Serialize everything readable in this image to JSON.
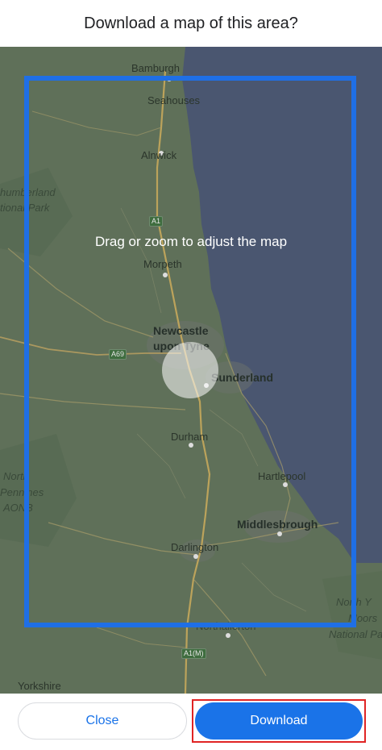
{
  "dialog": {
    "title": "Download a map of this area?",
    "hint": "Drag or zoom to adjust the map"
  },
  "map": {
    "places": {
      "bamburgh": "Bamburgh",
      "seahouses": "Seahouses",
      "alnwick": "Alnwick",
      "northumberland": "humberland",
      "national_park": "tional Park",
      "morpeth": "Morpeth",
      "newcastle_line1": "Newcastle",
      "newcastle_line2": "upon Tyne",
      "sunderland": "Sunderland",
      "durham": "Durham",
      "hartlepool": "Hartlepool",
      "north_pennines_1": "North",
      "north_pennines_2": "Pennines",
      "north_pennines_3": "AONB",
      "middlesbrough": "Middlesbrough",
      "darlington": "Darlington",
      "north_york_1": "North Y",
      "north_york_2": "Moors",
      "north_york_3": "National Pa",
      "northallerton": "Northallerton",
      "yorkshire": "Yorkshire"
    },
    "roads": {
      "a1": "A1",
      "a69": "A69",
      "a1m": "A1(M)"
    }
  },
  "footer": {
    "close_label": "Close",
    "download_label": "Download"
  },
  "colors": {
    "accent": "#1a73e8",
    "selection_border": "#1f6fe6",
    "highlight_outline": "#e02424"
  }
}
